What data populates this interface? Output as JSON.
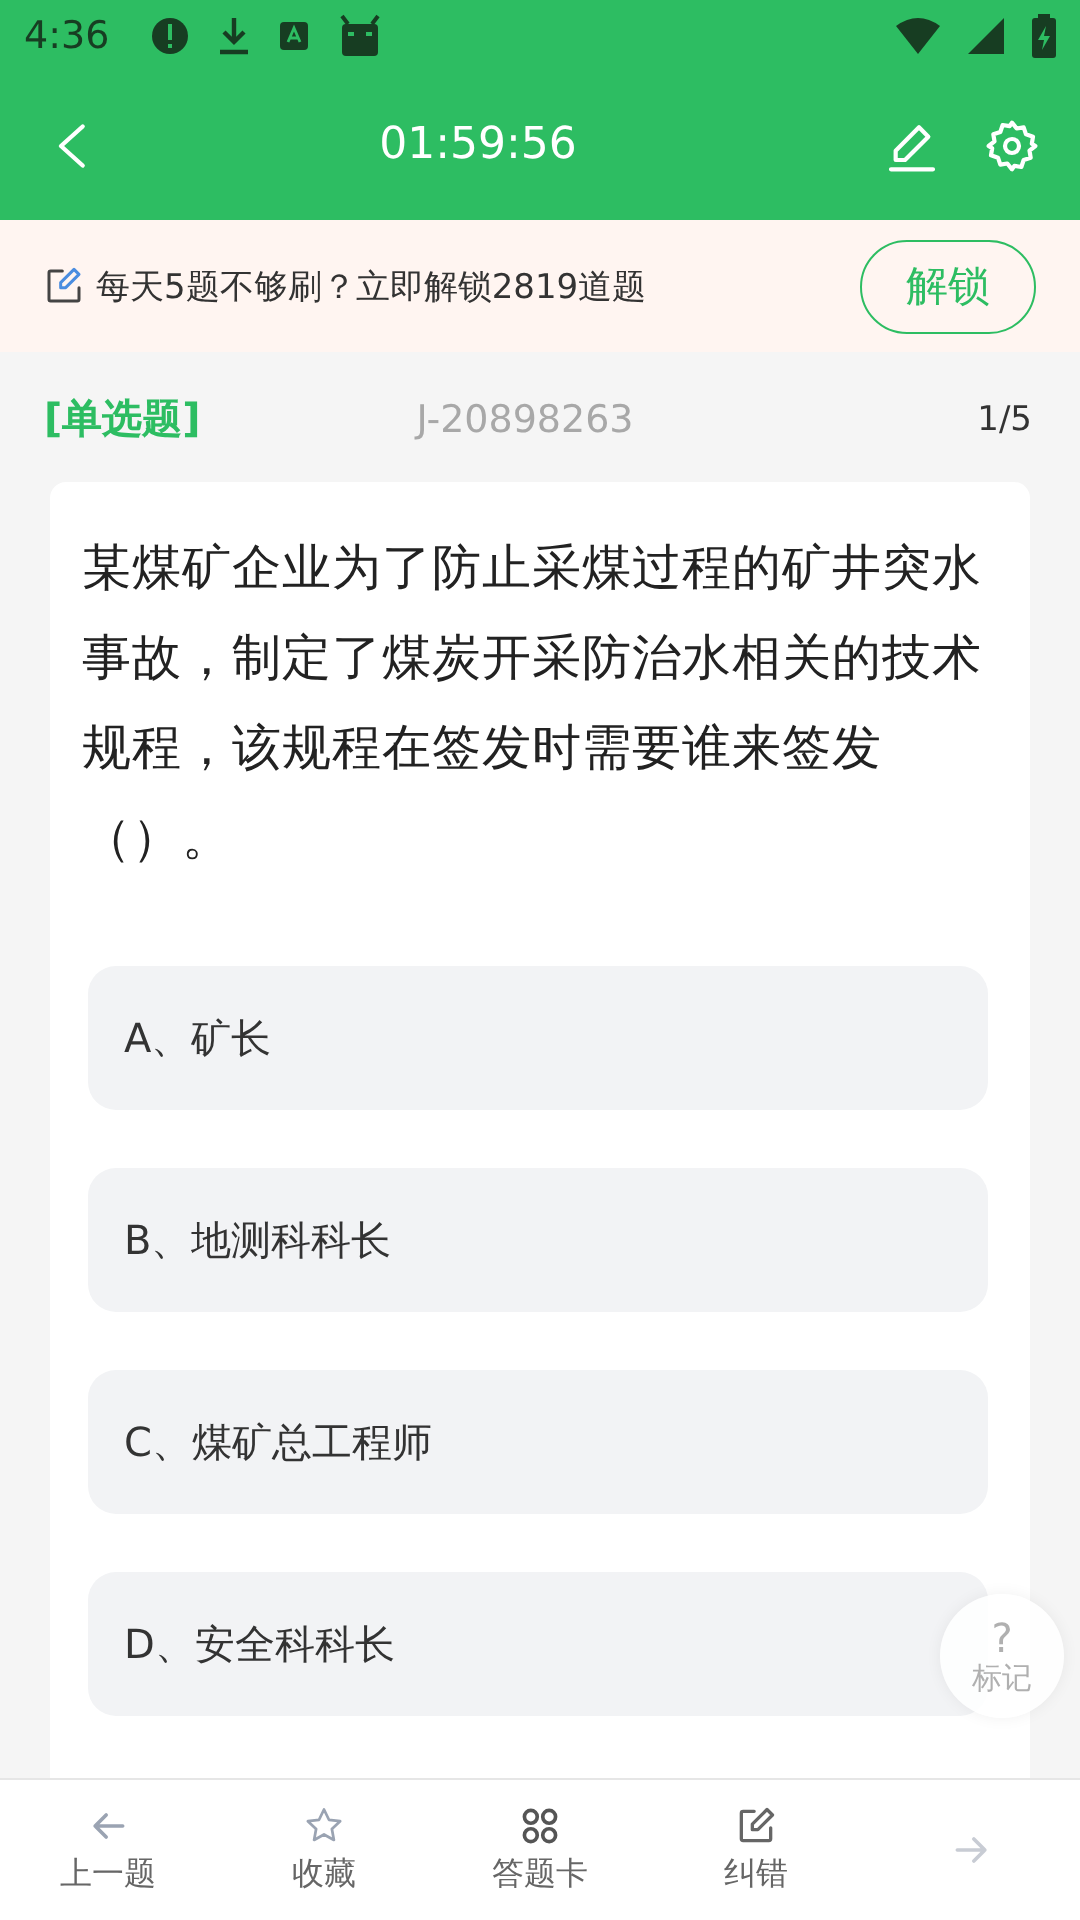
{
  "status_bar": {
    "time": "4:36"
  },
  "header": {
    "timer": "01:59:56"
  },
  "banner": {
    "text": "每天5题不够刷？立即解锁2819道题",
    "button": "解锁"
  },
  "question": {
    "type": "[单选题]",
    "code": "J-20898263",
    "progress": "1/5",
    "text": "某煤矿企业为了防止采煤过程的矿井突水事故，制定了煤炭开采防治水相关的技术规程，该规程在签发时需要谁来签发（）。",
    "options": [
      {
        "label": "A、矿长",
        "selected": false
      },
      {
        "label": "B、地测科科长",
        "selected": false
      },
      {
        "label": "C、煤矿总工程师",
        "selected": false
      },
      {
        "label": "D、安全科科长",
        "selected": false
      }
    ]
  },
  "mark_button": {
    "icon": "?",
    "label": "标记"
  },
  "bottom_nav": [
    {
      "kind": "prev",
      "label": "上一题"
    },
    {
      "kind": "star",
      "label": "收藏"
    },
    {
      "kind": "grid",
      "label": "答题卡"
    },
    {
      "kind": "edit",
      "label": "纠错"
    },
    {
      "kind": "next"
    }
  ]
}
